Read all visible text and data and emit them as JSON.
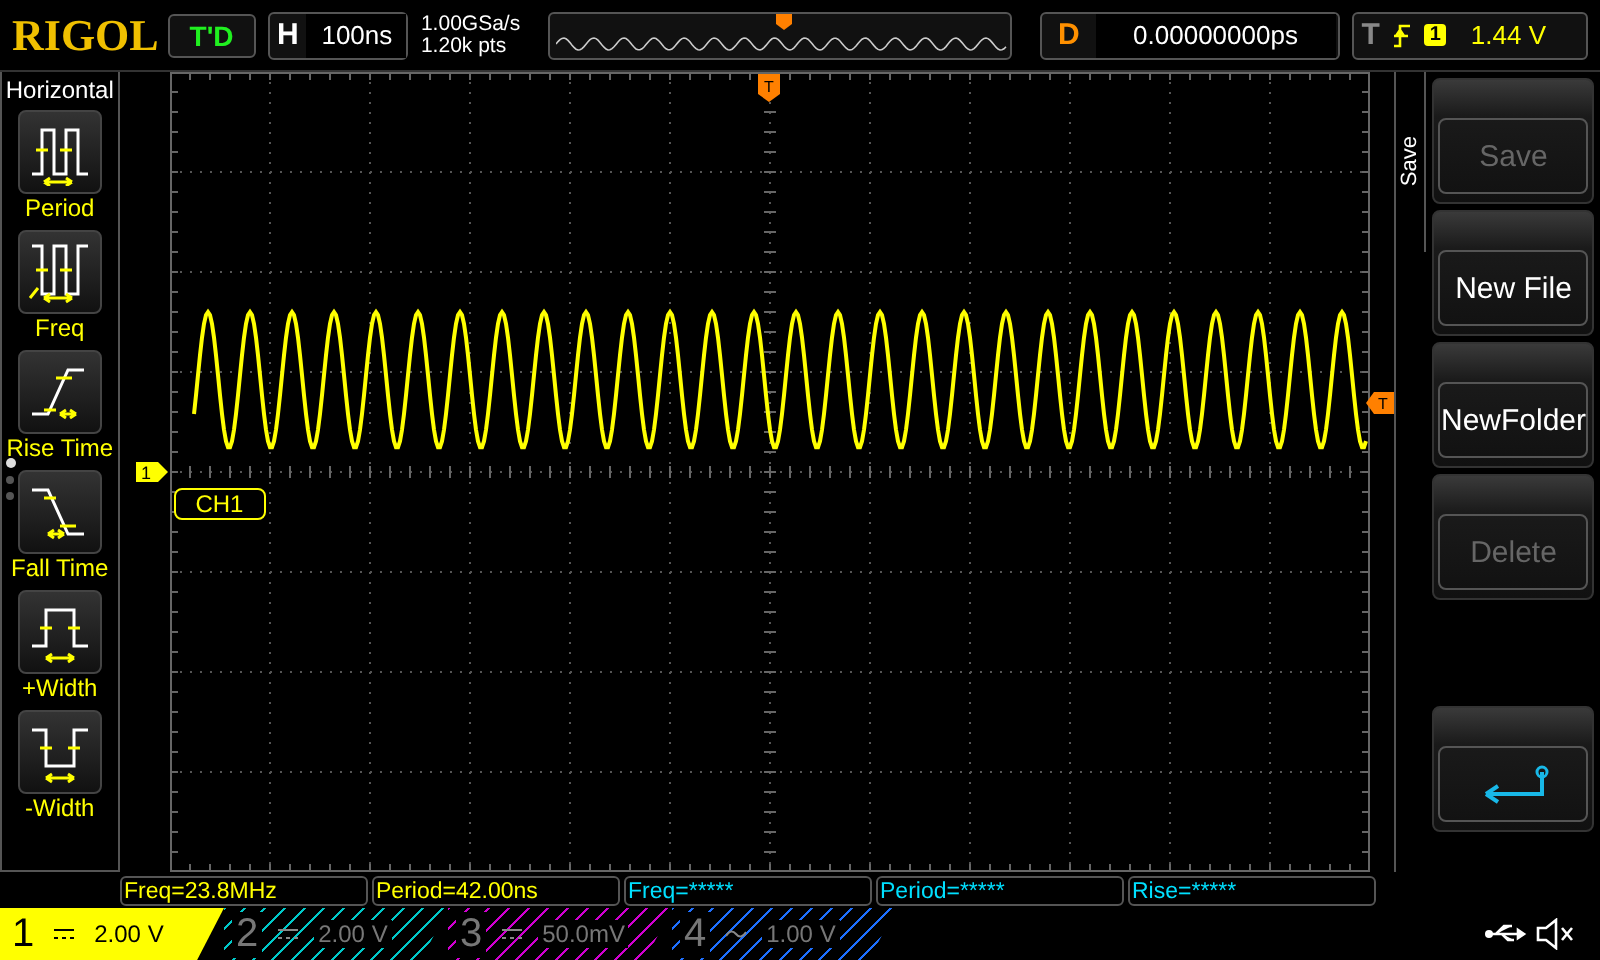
{
  "top_bar": {
    "logo": "RIGOL",
    "run_state": "T'D",
    "timebase": {
      "label": "H",
      "value": "100ns"
    },
    "sample_rate": "1.00GSa/s",
    "memory_depth": "1.20k pts",
    "delay": {
      "label": "D",
      "value": "0.00000000ps"
    },
    "trigger": {
      "label": "T",
      "source": "1",
      "level": "1.44 V"
    }
  },
  "left_menu": {
    "title": "Horizontal",
    "items": [
      {
        "label": "Period",
        "kind": "period"
      },
      {
        "label": "Freq",
        "kind": "freq"
      },
      {
        "label": "Rise Time",
        "kind": "rise"
      },
      {
        "label": "Fall Time",
        "kind": "fall"
      },
      {
        "label": "+Width",
        "kind": "pwidth"
      },
      {
        "label": "-Width",
        "kind": "nwidth"
      }
    ],
    "pages": [
      {
        "selected": true
      },
      {
        "selected": false
      },
      {
        "selected": false
      }
    ]
  },
  "screen": {
    "channel_marker": "1",
    "channel_label": "CH1",
    "trigger_marker": "T",
    "trigger_level_marker": "T"
  },
  "right_menu": {
    "title": "Save",
    "buttons": [
      {
        "kind": "text",
        "label": "Save",
        "disabled": true
      },
      {
        "kind": "text",
        "label": "New File",
        "disabled": false
      },
      {
        "kind": "text",
        "label": "NewFolder",
        "disabled": false
      },
      {
        "kind": "text",
        "label": "Delete",
        "disabled": true
      },
      {
        "kind": "spacer"
      },
      {
        "kind": "return"
      }
    ]
  },
  "measurements": [
    {
      "text": "Freq=23.8MHz",
      "color": "#ffff00"
    },
    {
      "text": "Period=42.00ns",
      "color": "#ffff00"
    },
    {
      "text": "Freq=*****",
      "color": "#00e0ff"
    },
    {
      "text": "Period=*****",
      "color": "#00e0ff"
    },
    {
      "text": "Rise=*****",
      "color": "#00e0ff"
    }
  ],
  "channels": [
    {
      "number": "1",
      "kind": "dc",
      "scale": "2.00 V",
      "color": "#ffff00",
      "selected": true
    },
    {
      "number": "2",
      "kind": "dc",
      "scale": "2.00 V",
      "color": "#00c8c8",
      "selected": false
    },
    {
      "number": "3",
      "kind": "dc",
      "scale": "50.0mV",
      "color": "#d000d0",
      "selected": false
    },
    {
      "number": "4",
      "kind": "ac",
      "scale": "1.00 V",
      "color": "#1e70ff",
      "selected": false
    }
  ]
}
